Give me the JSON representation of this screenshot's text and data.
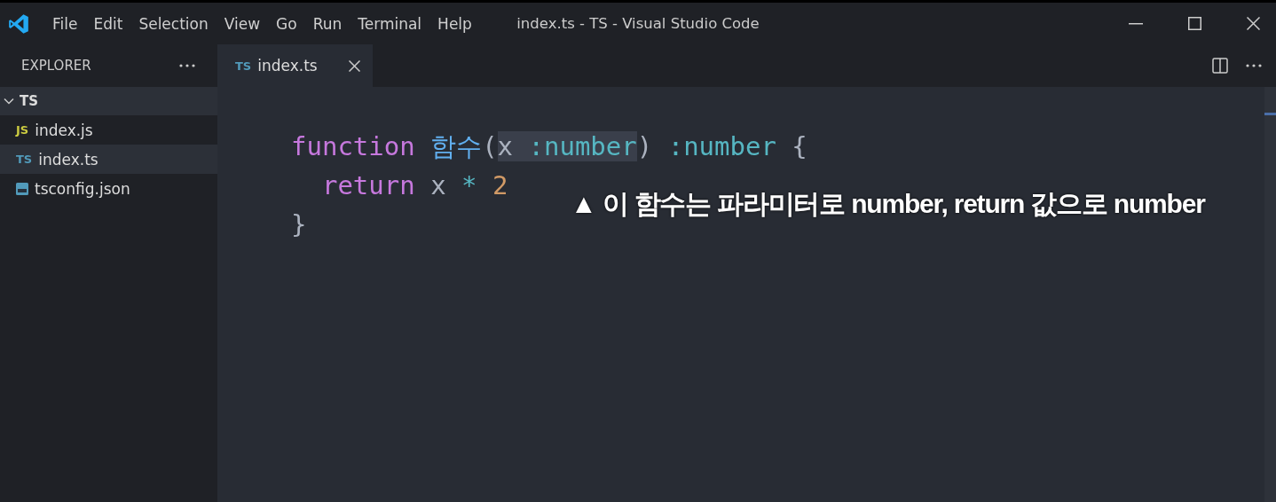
{
  "window": {
    "title": "index.ts - TS - Visual Studio Code"
  },
  "menu": [
    "File",
    "Edit",
    "Selection",
    "View",
    "Go",
    "Run",
    "Terminal",
    "Help"
  ],
  "sidebar": {
    "title": "EXPLORER",
    "folder": {
      "name": "TS",
      "expanded": true,
      "children": [
        {
          "name": "index.js",
          "kind": "js",
          "badge": "JS",
          "selected": false
        },
        {
          "name": "index.ts",
          "kind": "ts",
          "badge": "TS",
          "selected": true
        },
        {
          "name": "tsconfig.json",
          "kind": "tsconfig",
          "selected": false
        }
      ]
    }
  },
  "tabs": [
    {
      "label": "index.ts",
      "kind": "ts",
      "badge": "TS",
      "selected": true
    }
  ],
  "code": [
    [
      {
        "text": "function ",
        "kind": "keyword",
        "highlighted": false
      },
      {
        "text": "함수",
        "kind": "function",
        "highlighted": false
      },
      {
        "text": "(",
        "kind": "punct",
        "highlighted": false
      },
      {
        "text": "x ",
        "kind": "variable",
        "highlighted": true
      },
      {
        "text": ":number",
        "kind": "type",
        "highlighted": true
      },
      {
        "text": ") ",
        "kind": "punct",
        "highlighted": false
      },
      {
        "text": ":number ",
        "kind": "type",
        "highlighted": false
      },
      {
        "text": "{",
        "kind": "punct",
        "highlighted": false
      }
    ],
    [
      {
        "text": "  return ",
        "kind": "keyword",
        "highlighted": false
      },
      {
        "text": "x ",
        "kind": "variable",
        "highlighted": false
      },
      {
        "text": "* ",
        "kind": "operator",
        "highlighted": false
      },
      {
        "text": "2",
        "kind": "number",
        "highlighted": false
      }
    ],
    [
      {
        "text": "}",
        "kind": "punct",
        "highlighted": false
      }
    ]
  ],
  "caption": "▲ 이 함수는 파라미터로 number, return 값으로 number"
}
